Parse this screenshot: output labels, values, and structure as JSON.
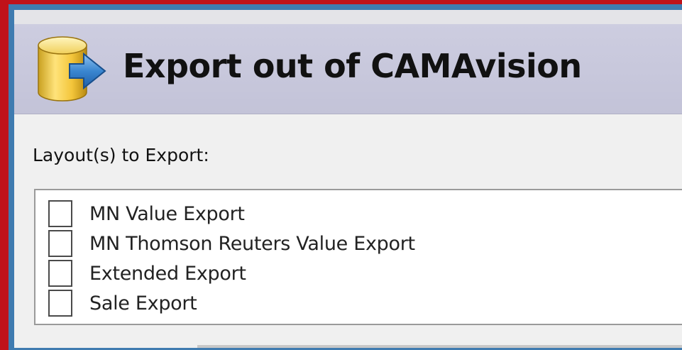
{
  "header": {
    "title": "Export out of CAMAvision",
    "icon": "database-export-icon"
  },
  "layouts": {
    "label": "Layout(s) to Export:",
    "items": [
      {
        "label": "MN Value Export",
        "checked": false
      },
      {
        "label": "MN Thomson Reuters Value Export",
        "checked": false
      },
      {
        "label": "Extended Export",
        "checked": false
      },
      {
        "label": "Sale Export",
        "checked": false
      }
    ]
  },
  "colors": {
    "outer_border": "#c0121a",
    "window_frame": "#3f7bb0",
    "header_bg": "#c8c8dc"
  }
}
